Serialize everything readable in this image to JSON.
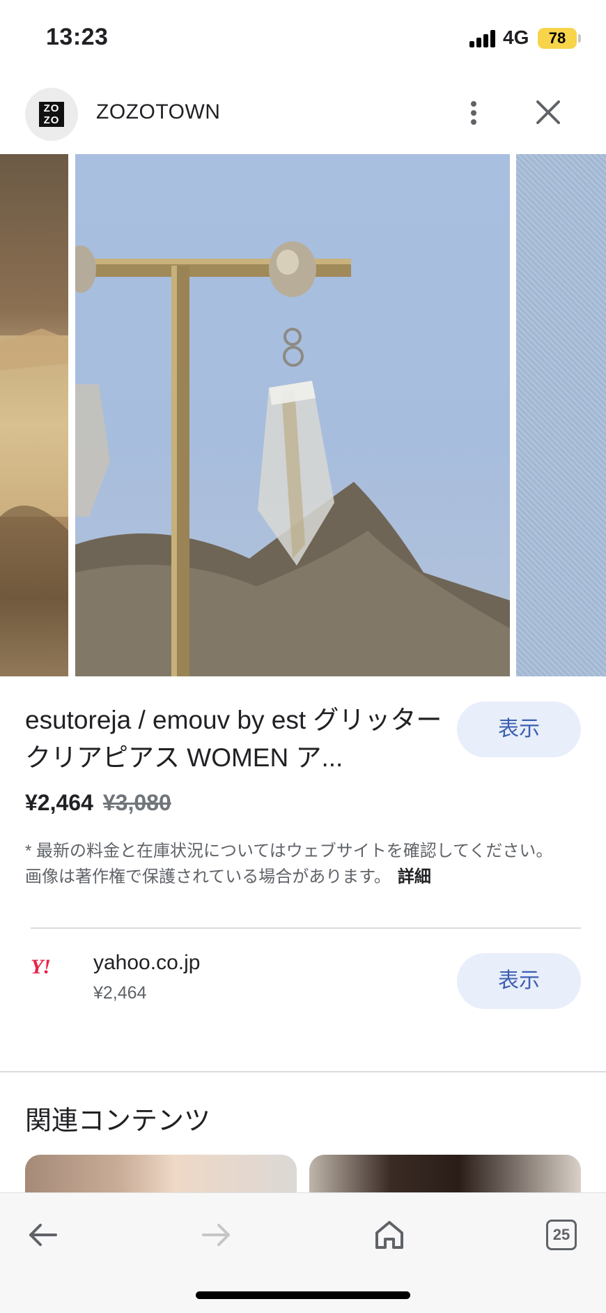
{
  "status_bar": {
    "time": "13:23",
    "network": "4G",
    "battery": "78"
  },
  "header": {
    "logo_text": "ZO ZO",
    "site_name": "ZOZOTOWN",
    "more_icon": "more-vert-icon",
    "close_icon": "close-icon"
  },
  "product": {
    "title": "esutoreja / emouv by est グリッタークリアピアス WOMEN ア...",
    "view_label": "表示",
    "price": "¥2,464",
    "old_price": "¥3,080",
    "disclaimer": "* 最新の料金と在庫状況についてはウェブサイトを確認してください。 画像は著作権で保護されている場合があります。",
    "details_label": "詳細"
  },
  "seller": {
    "logo_text": "Y!",
    "name": "yahoo.co.jp",
    "price": "¥2,464",
    "view_label": "表示"
  },
  "related": {
    "title": "関連コンテンツ"
  },
  "toolbar": {
    "back_icon": "back-arrow-icon",
    "forward_icon": "forward-arrow-icon",
    "home_icon": "home-icon",
    "tab_count": "25"
  },
  "colors": {
    "accent_button_bg": "#e8eefa",
    "accent_button_text": "#3c5fb0",
    "battery": "#f7d44a",
    "yahoo_red": "#e8254a"
  }
}
